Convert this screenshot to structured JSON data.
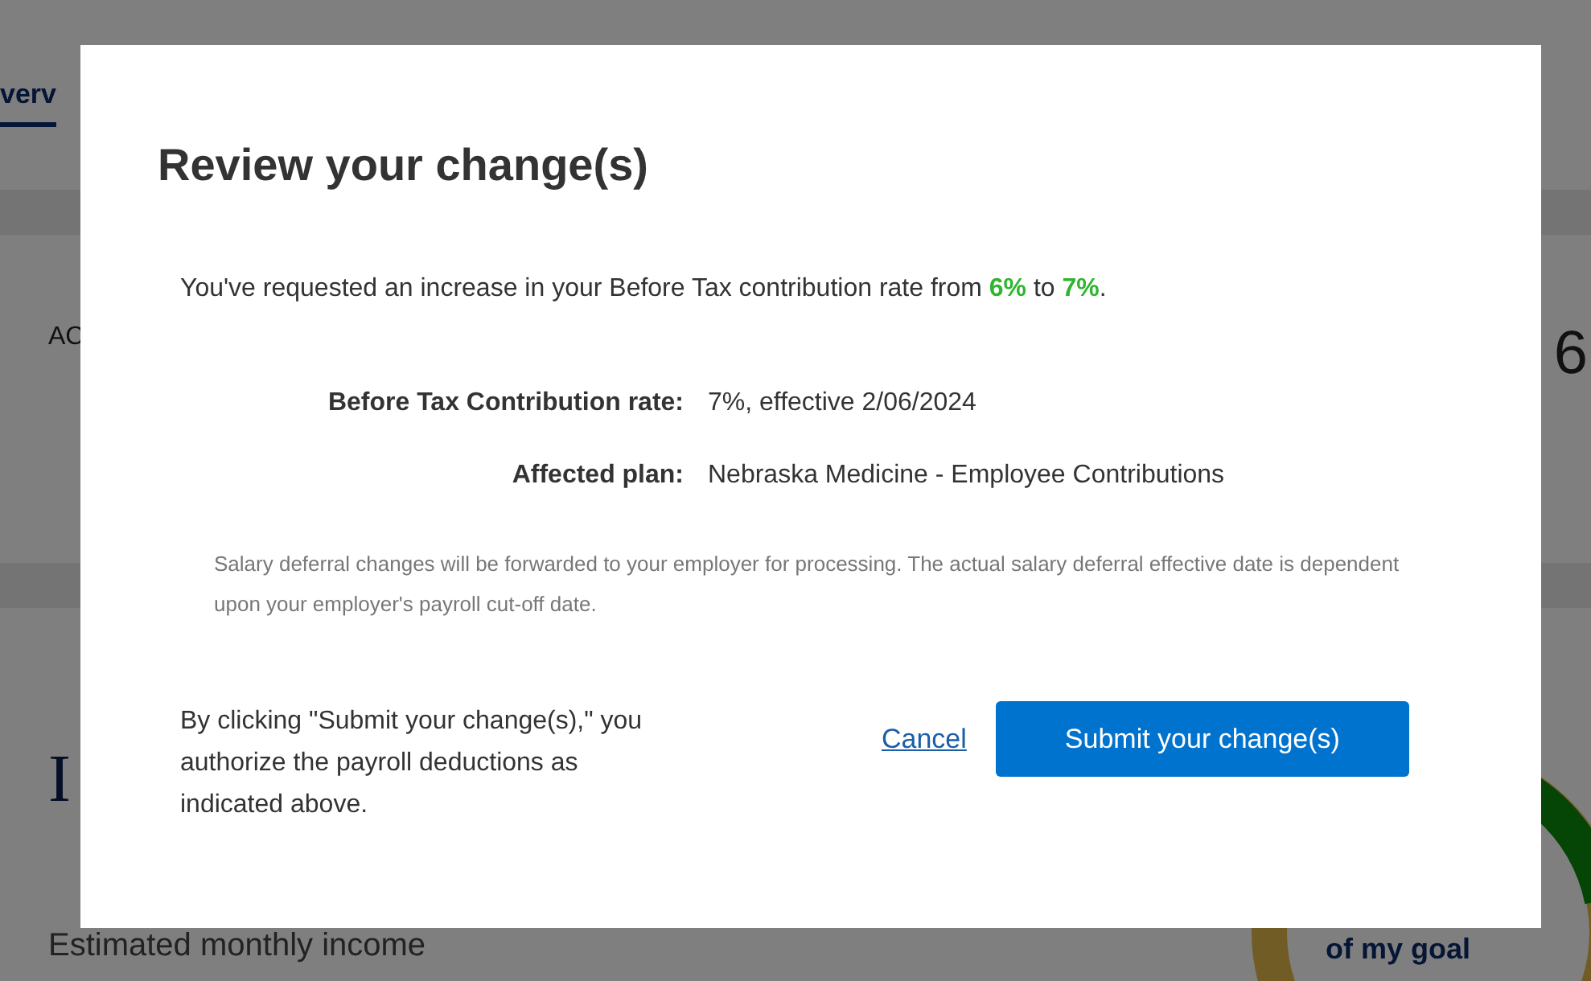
{
  "background": {
    "tab": {
      "label": "verv",
      "selected": true
    },
    "card_label": "AC",
    "card_value": "6",
    "income_heading": "I",
    "income_label": "Estimated monthly income",
    "goal_label": "of my goal"
  },
  "dialog": {
    "title": "Review your change(s)",
    "intro": {
      "before": "You've requested an increase in your Before Tax contribution rate from ",
      "from_rate": "6%",
      "middle": " to ",
      "to_rate": "7%",
      "after": "."
    },
    "details": [
      {
        "label": "Before Tax Contribution rate:",
        "value": "7%, effective 2/06/2024"
      },
      {
        "label": "Affected plan:",
        "value": "Nebraska Medicine - Employee Contributions"
      }
    ],
    "note": "Salary deferral changes will be forwarded to your employer for processing. The actual salary deferral effective date is dependent upon your employer's payroll cut-off date.",
    "authorization": "By clicking \"Submit your change(s),\" you authorize the payroll deductions as indicated above.",
    "cancel": "Cancel",
    "submit": "Submit your change(s)"
  }
}
